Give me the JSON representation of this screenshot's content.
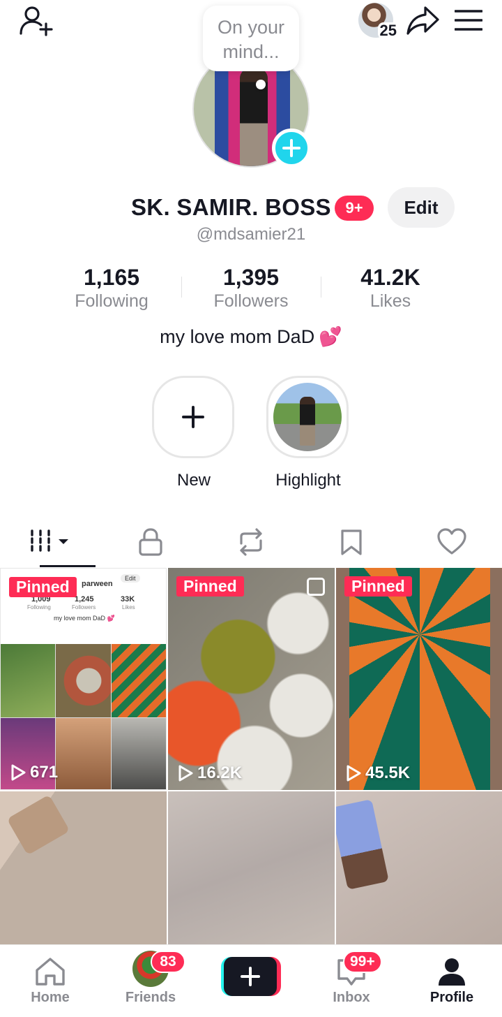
{
  "header": {
    "story_count": "25"
  },
  "bubble": {
    "line1": "On your",
    "line2": "mind..."
  },
  "profile": {
    "display_name": "SK. SAMIR. BOSS",
    "name_badge": "9+",
    "edit_label": "Edit",
    "username": "@mdsamier21",
    "bio": "my love mom DaD",
    "bio_emoji": "💕"
  },
  "stats": [
    {
      "value": "1,165",
      "label": "Following"
    },
    {
      "value": "1,395",
      "label": "Followers"
    },
    {
      "value": "41.2K",
      "label": "Likes"
    }
  ],
  "highlights": [
    {
      "label": "New"
    },
    {
      "label": "Highlight"
    }
  ],
  "tabs": [
    "videos-grid-icon",
    "lock-icon",
    "repost-icon",
    "bookmark-icon",
    "heart-icon"
  ],
  "videos": [
    {
      "pinned": "Pinned",
      "views": "671"
    },
    {
      "pinned": "Pinned",
      "views": "16.2K"
    },
    {
      "pinned": "Pinned",
      "views": "45.5K"
    }
  ],
  "mini_profile": {
    "name": "parween",
    "edit": "Edit",
    "following_num": "1,009",
    "following_lbl": "Following",
    "followers_num": "1,245",
    "followers_lbl": "Followers",
    "likes_num": "33K",
    "likes_lbl": "Likes",
    "bio": "my love mom DaD 💕"
  },
  "bottom_nav": {
    "home": "Home",
    "friends": "Friends",
    "friends_badge": "83",
    "inbox": "Inbox",
    "inbox_badge": "99+",
    "profile": "Profile"
  },
  "colors": {
    "accent": "#fe2c55",
    "cyan": "#20d5ec",
    "text": "#161823",
    "muted": "#8a8b91"
  }
}
